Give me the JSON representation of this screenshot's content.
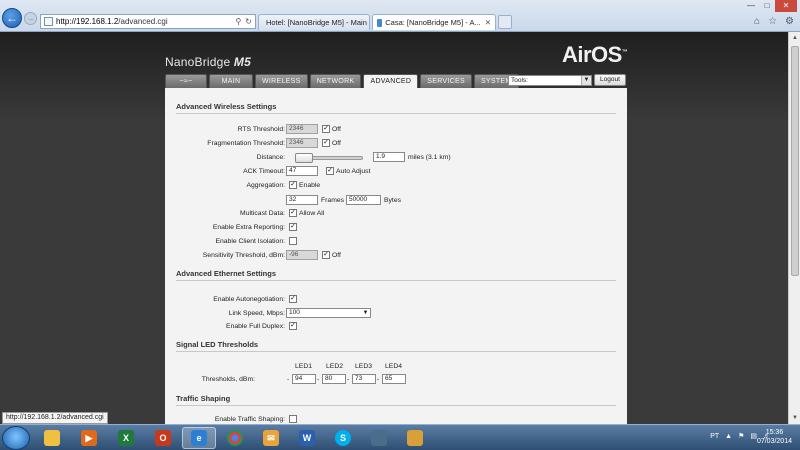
{
  "browser": {
    "address": "http://192.168.1.2/advanced.cgi",
    "address_host": "http://192.168.1.2",
    "address_path": "/advanced.cgi",
    "tabs": [
      {
        "label": "Hotel: [NanoBridge M5] - Main"
      },
      {
        "label": "Casa: [NanoBridge M5] - A..."
      }
    ],
    "status_url": "http://192.168.1.2/advanced.cgi"
  },
  "header": {
    "brand": "NanoBridge",
    "brand_model": "M5",
    "airos": "AirOS",
    "tm": "™"
  },
  "nav": {
    "tabs": [
      "MAIN",
      "WIRELESS",
      "NETWORK",
      "ADVANCED",
      "SERVICES",
      "SYSTEM"
    ],
    "active": "ADVANCED",
    "tools_value": "Tools:",
    "logout_label": "Logout"
  },
  "wireless": {
    "title": "Advanced Wireless Settings",
    "rts_label": "RTS Threshold:",
    "rts_value": "2346",
    "rts_off_label": "Off",
    "frag_label": "Fragmentation Threshold:",
    "frag_value": "2346",
    "frag_off_label": "Off",
    "distance_label": "Distance:",
    "distance_value": "1.9",
    "distance_unit": "miles (3.1 km)",
    "ack_label": "ACK Timeout:",
    "ack_value": "47",
    "ack_auto_label": "Auto Adjust",
    "agg_label": "Aggregation:",
    "agg_enable_label": "Enable",
    "agg_frames": "32",
    "agg_frames_label": "Frames",
    "agg_bytes": "50000",
    "agg_bytes_label": "Bytes",
    "multicast_label": "Multicast Data:",
    "multicast_allow_label": "Allow All",
    "extra_reporting_label": "Enable Extra Reporting:",
    "client_isolation_label": "Enable Client Isolation:",
    "sensitivity_label": "Sensitivity Threshold, dBm:",
    "sensitivity_value": "-96",
    "sensitivity_off_label": "Off"
  },
  "ethernet": {
    "title": "Advanced Ethernet Settings",
    "autoneg_label": "Enable Autonegotiation:",
    "link_speed_label": "Link Speed, Mbps:",
    "link_speed_value": "100",
    "full_duplex_label": "Enable Full Duplex:"
  },
  "led": {
    "title": "Signal LED Thresholds",
    "headers": [
      "LED1",
      "LED2",
      "LED3",
      "LED4"
    ],
    "thresholds_label": "Thresholds, dBm:",
    "values": [
      "94",
      "80",
      "73",
      "65"
    ],
    "dash": "-"
  },
  "traffic": {
    "title": "Traffic Shaping",
    "enable_label": "Enable Traffic Shaping:"
  },
  "taskbar": {
    "lang": "PT",
    "time": "15:36",
    "date": "07/03/2014"
  }
}
